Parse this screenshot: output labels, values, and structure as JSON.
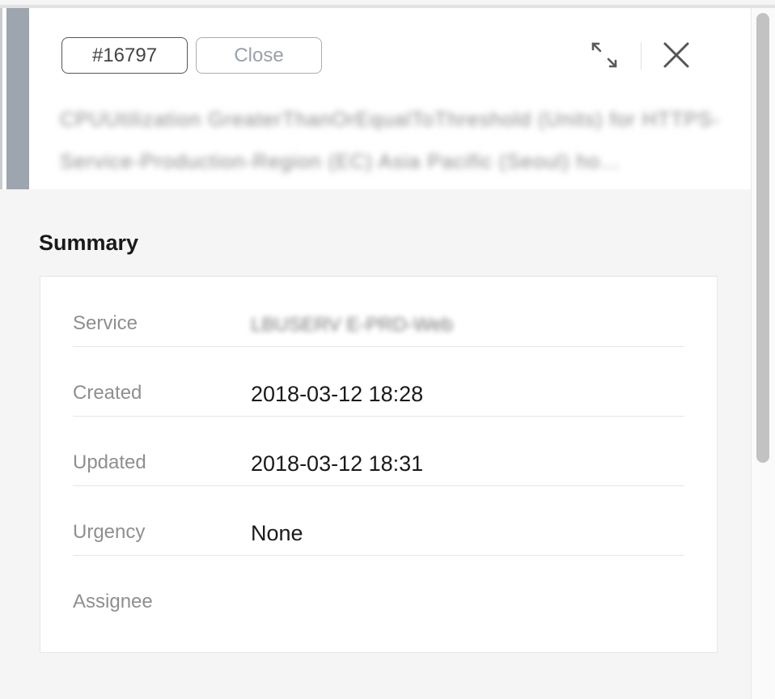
{
  "incident": {
    "id_label": "#16797",
    "close_label": "Close",
    "title": "CPUUtilization GreaterThanOrEqualToThreshold (Units) for HTTPS-Service-Production-Region (EC) Asia Pacific (Seoul) ho…"
  },
  "icons": {
    "expand": "expand-icon",
    "close": "close-icon"
  },
  "summary": {
    "heading": "Summary",
    "rows": [
      {
        "label": "Service",
        "value": "LBUSERV E-PRD-Web",
        "blurred": true
      },
      {
        "label": "Created",
        "value": "2018-03-12 18:28"
      },
      {
        "label": "Updated",
        "value": "2018-03-12 18:31"
      },
      {
        "label": "Urgency",
        "value": "None"
      },
      {
        "label": "Assignee",
        "value": ""
      }
    ]
  }
}
